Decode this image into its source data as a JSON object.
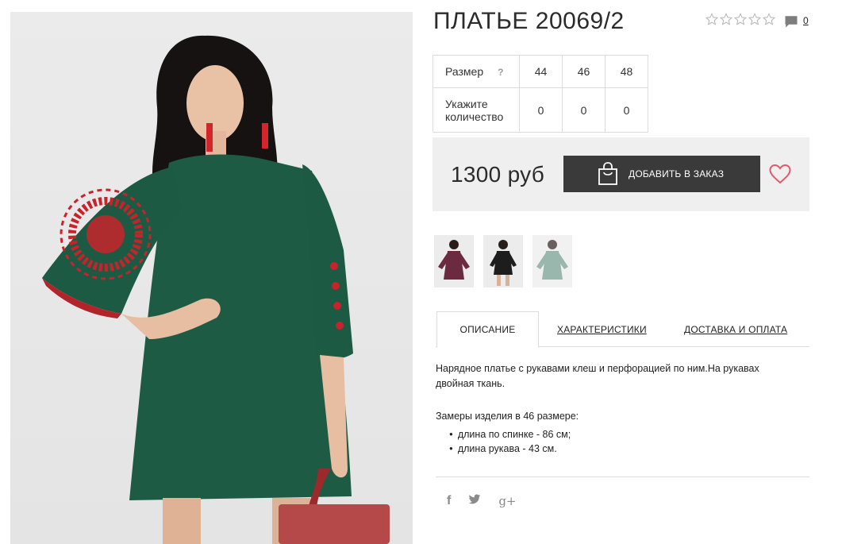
{
  "product": {
    "title": "ПЛАТЬЕ 20069/2",
    "rating_stars": 0,
    "rating_max": 5,
    "comments_count": "0"
  },
  "sizes": {
    "size_label": "Размер",
    "size_hint": "?",
    "qty_label_line1": "Укажите",
    "qty_label_line2": "количество",
    "values": [
      "44",
      "46",
      "48"
    ],
    "quantities": [
      "0",
      "0",
      "0"
    ]
  },
  "buy": {
    "price": "1300 руб",
    "add_label": "ДОБАВИТЬ В ЗАКАЗ"
  },
  "thumbnails": [
    {
      "color": "#6b2a3f",
      "label": "burgundy"
    },
    {
      "color": "#1d1d1d",
      "label": "black"
    },
    {
      "color": "#6f9a8a",
      "label": "green"
    }
  ],
  "tabs": {
    "description": "ОПИСАНИЕ",
    "characteristics": "ХАРАКТЕРИСТИКИ",
    "delivery": "ДОСТАВКА И ОПЛАТА"
  },
  "description": {
    "text": "Нарядное платье с рукавами клеш и перфорацией по ним.На рукавах двойная ткань.",
    "measure_title": "Замеры изделия в 46 размере:",
    "measures": [
      "длина по спинке - 86 см;",
      "длина рукава - 43 см."
    ]
  },
  "social": {
    "facebook": "f",
    "google": "g+"
  },
  "colors": {
    "accent_heart": "#e05a6a",
    "button_bg": "#3a3a3a",
    "dress_green": "#1e5b45"
  }
}
